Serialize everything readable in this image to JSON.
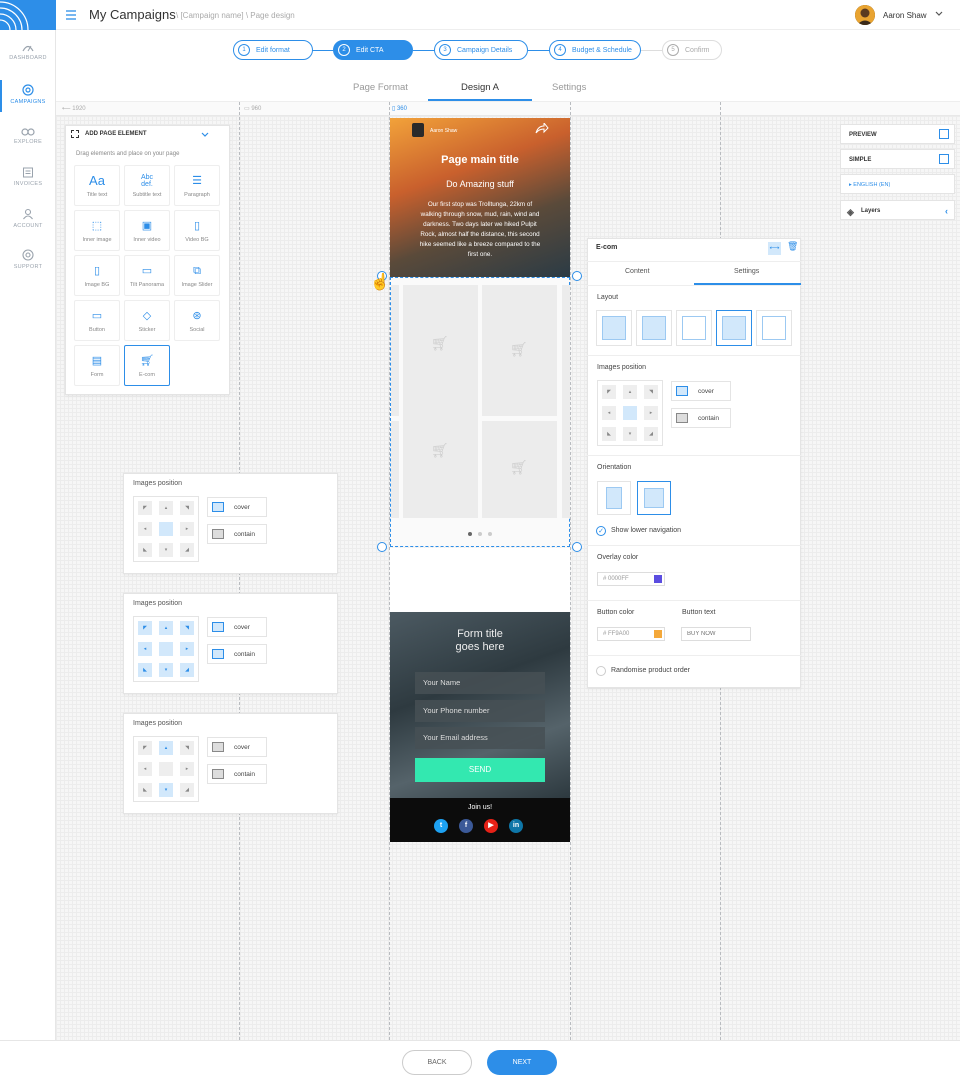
{
  "header": {
    "title": "My Campaigns",
    "breadcrumb": "\\ [Campaign name] \\ Page design",
    "user_name": "Aaron Shaw"
  },
  "sidebar": {
    "items": [
      {
        "label": "DASHBOARD",
        "icon": "dashboard-icon"
      },
      {
        "label": "CAMPAIGNS",
        "icon": "target-icon",
        "active": true
      },
      {
        "label": "EXPLORE",
        "icon": "binoculars-icon"
      },
      {
        "label": "INVOICES",
        "icon": "invoice-icon"
      },
      {
        "label": "ACCOUNT",
        "icon": "user-icon"
      },
      {
        "label": "SUPPORT",
        "icon": "support-icon"
      }
    ]
  },
  "steps": [
    {
      "num": "1",
      "label": "Edit format"
    },
    {
      "num": "2",
      "label": "Edit CTA"
    },
    {
      "num": "3",
      "label": "Campaign Details"
    },
    {
      "num": "4",
      "label": "Budget & Schedule"
    },
    {
      "num": "5",
      "label": "Confirm"
    }
  ],
  "tabs": [
    "Page Format",
    "Design A",
    "Settings"
  ],
  "ruler": {
    "r1": "1920",
    "r2": "960",
    "r3": "360"
  },
  "elements_panel": {
    "title": "ADD PAGE ELEMENT",
    "hint": "Drag elements and place on your page",
    "items": [
      "Title text",
      "Subtitle text",
      "Paragraph",
      "Inner image",
      "Inner video",
      "Video BG",
      "Image BG",
      "Tilt Panorama",
      "Image Slider",
      "Button",
      "Sticker",
      "Social",
      "Form",
      "E-com"
    ]
  },
  "position_panels": {
    "title": "Images position",
    "cover": "cover",
    "contain": "contain"
  },
  "phone": {
    "account": "Aaron Shaw",
    "hero_title": "Page main title",
    "hero_subtitle": "Do Amazing stuff",
    "hero_text": "Our first stop was Trolltunga, 22km of walking through snow, mud, rain, wind and darkness. Two days later we hiked Pulpit Rock, almost half the distance, this second hike seemed like a breeze compared to the first one.",
    "form_title": "Form title goes here",
    "fields": [
      "Your Name",
      "Your Phone number",
      "Your Email address"
    ],
    "send": "SEND",
    "join": "Join us!"
  },
  "right_panel": {
    "preview": "PREVIEW",
    "simple": "SIMPLE",
    "language": "ENGLISH (EN)",
    "layers": "Layers"
  },
  "ecom_panel": {
    "title": "E-com",
    "tabs": [
      "Content",
      "Settings"
    ],
    "layout": "Layout",
    "images_position": "Images position",
    "cover": "cover",
    "contain": "contain",
    "orientation": "Orientation",
    "lower_nav": "Show lower navigation",
    "overlay_color": "Overlay color",
    "overlay_value": "# 0000FF",
    "button_color": "Button color",
    "button_color_value": "# FF9A00",
    "button_text": "Button text",
    "button_text_placeholder": "BUY NOW",
    "randomise": "Randomise product order"
  },
  "colors": {
    "accent": "#2d8ee8",
    "send": "#33e8b0",
    "overlay": "#5b4de0",
    "button": "#f4a83a"
  },
  "footer": {
    "back": "BACK",
    "next": "NEXT"
  }
}
